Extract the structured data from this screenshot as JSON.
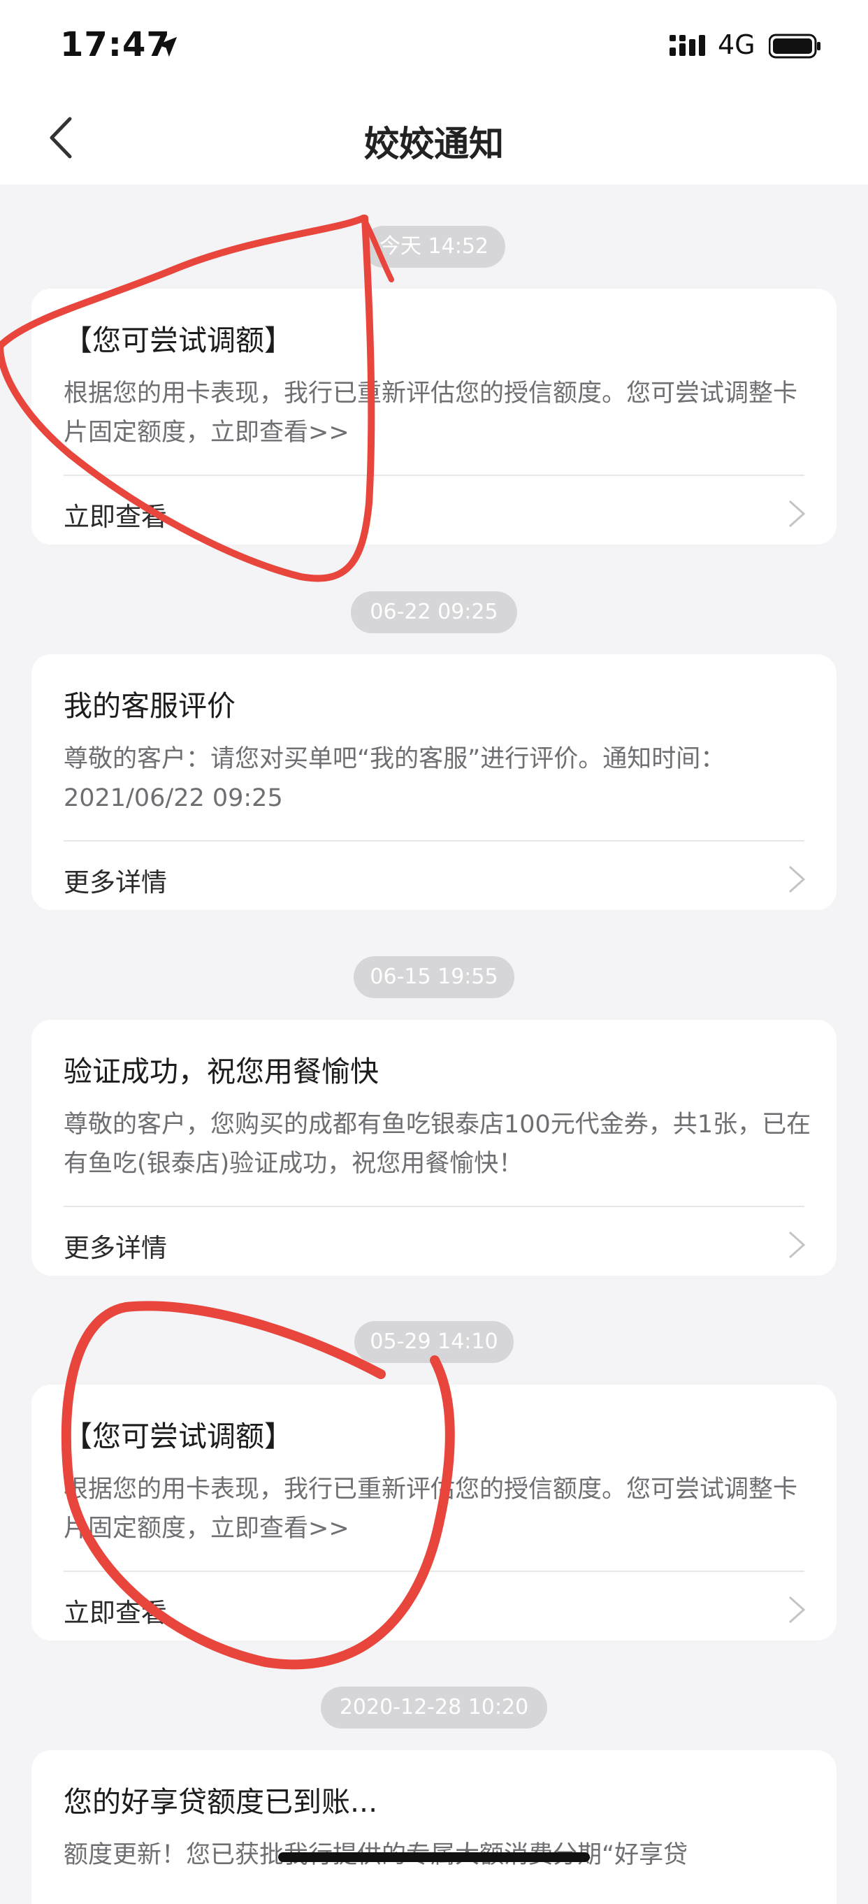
{
  "status_bar": {
    "time": "17:47",
    "network": "4G"
  },
  "nav": {
    "title": "姣姣通知"
  },
  "notifications": [
    {
      "timestamp": "今天 14:52",
      "title": "【您可尝试调额】",
      "body": "根据您的用卡表现，我行已重新评估您的授信额度。您可尝试调整卡片固定额度，立即查看>>",
      "action": "立即查看"
    },
    {
      "timestamp": "06-22 09:25",
      "title": "我的客服评价",
      "body": "尊敬的客户：请您对买单吧“我的客服”进行评价。通知时间：2021/06/22 09:25",
      "action": "更多详情"
    },
    {
      "timestamp": "06-15 19:55",
      "title": "验证成功，祝您用餐愉快",
      "body": "尊敬的客户，您购买的成都有鱼吃银泰店100元代金券，共1张，已在有鱼吃(银泰店)验证成功，祝您用餐愉快！",
      "action": "更多详情"
    },
    {
      "timestamp": "05-29 14:10",
      "title": "【您可尝试调额】",
      "body": "根据您的用卡表现，我行已重新评估您的授信额度。您可尝试调整卡片固定额度，立即查看>>",
      "action": "立即查看"
    },
    {
      "timestamp": "2020-12-28 10:20",
      "title": "您的好享贷额度已到账...",
      "body": "额度更新！您已获批我行提供的专属大额消费分期“好享贷",
      "action": ""
    }
  ],
  "colors": {
    "background": "#f4f4f6",
    "card": "#ffffff",
    "timestamp_pill": "#d6d6d8",
    "annotation": "#e8453c"
  }
}
